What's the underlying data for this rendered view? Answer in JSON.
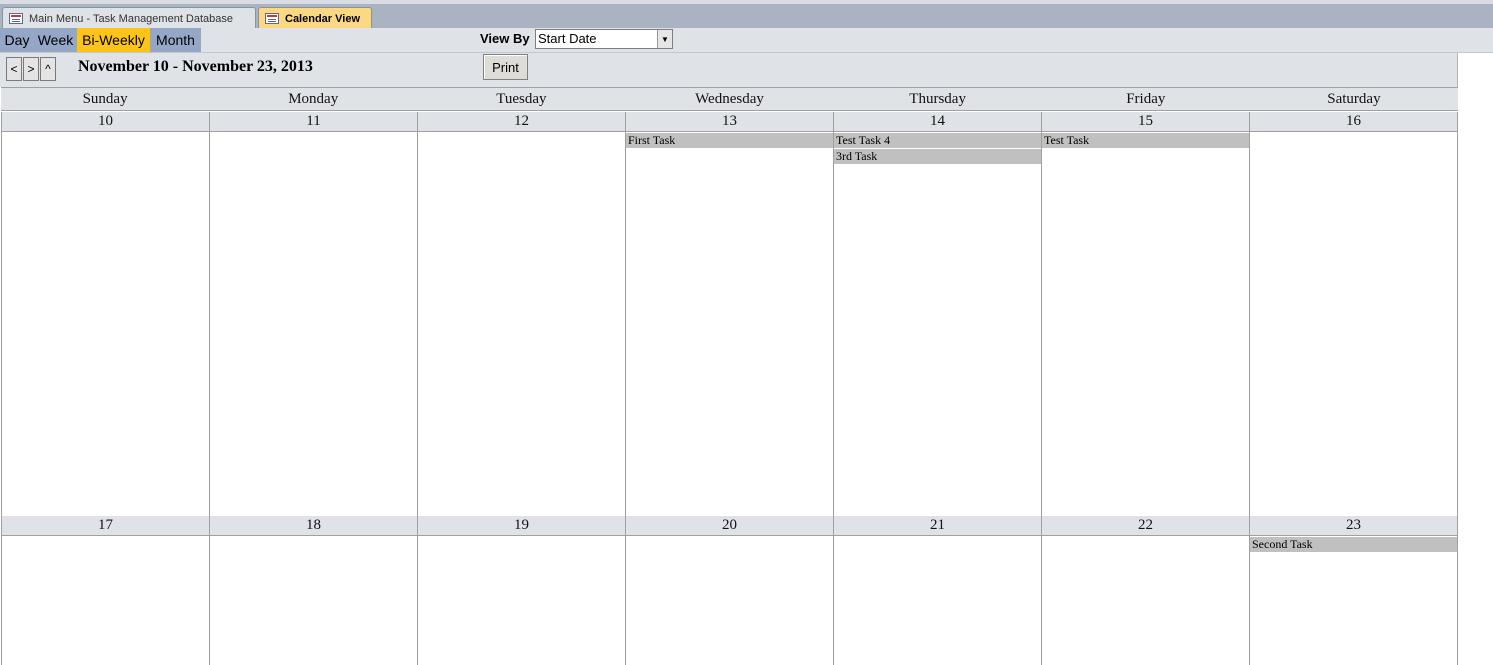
{
  "tabs": [
    {
      "label": "Main Menu - Task Management Database",
      "active": false
    },
    {
      "label": "Calendar View",
      "active": true
    }
  ],
  "view_buttons": [
    {
      "label": "Day",
      "selected": false
    },
    {
      "label": "Week",
      "selected": false
    },
    {
      "label": "Bi-Weekly",
      "selected": true
    },
    {
      "label": "Month",
      "selected": false
    }
  ],
  "view_by": {
    "label": "View By",
    "value": "Start Date"
  },
  "nav": {
    "prev": "<",
    "next": ">",
    "up": "^"
  },
  "range_title": "November 10 - November 23, 2013",
  "print_label": "Print",
  "day_names": [
    "Sunday",
    "Monday",
    "Tuesday",
    "Wednesday",
    "Thursday",
    "Friday",
    "Saturday"
  ],
  "weeks": [
    {
      "days": [
        {
          "date": "10",
          "tasks": []
        },
        {
          "date": "11",
          "tasks": []
        },
        {
          "date": "12",
          "tasks": []
        },
        {
          "date": "13",
          "tasks": [
            "First Task"
          ]
        },
        {
          "date": "14",
          "tasks": [
            "Test Task 4",
            "3rd Task"
          ]
        },
        {
          "date": "15",
          "tasks": [
            "Test Task"
          ]
        },
        {
          "date": "16",
          "tasks": []
        }
      ]
    },
    {
      "days": [
        {
          "date": "17",
          "tasks": []
        },
        {
          "date": "18",
          "tasks": []
        },
        {
          "date": "19",
          "tasks": []
        },
        {
          "date": "20",
          "tasks": []
        },
        {
          "date": "21",
          "tasks": []
        },
        {
          "date": "22",
          "tasks": []
        },
        {
          "date": "23",
          "tasks": [
            "Second Task"
          ]
        }
      ]
    }
  ],
  "colors": {
    "selected_view": "#fbc417",
    "view_button": "#95a7c6",
    "active_tab": "#fcd883",
    "header_band": "#dfe3e8",
    "task_bar": "#c0c0c0"
  }
}
